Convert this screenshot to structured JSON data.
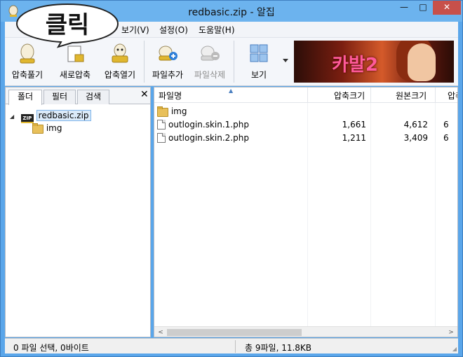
{
  "window": {
    "title": "redbasic.zip - 알집",
    "minimize_glyph": "—",
    "maximize_glyph": "□",
    "close_glyph": "✕"
  },
  "menu": {
    "items": [
      "보기(V)",
      "설정(O)",
      "도움말(H)"
    ]
  },
  "callout": {
    "text": "클릭"
  },
  "toolbar": {
    "buttons": [
      {
        "label": "압축풀기",
        "icon": "extract-egg-icon"
      },
      {
        "label": "새로압축",
        "icon": "new-archive-icon"
      },
      {
        "label": "압축열기",
        "icon": "open-archive-icon"
      },
      {
        "label": "파일추가",
        "icon": "add-file-icon"
      },
      {
        "label": "파일삭제",
        "icon": "delete-file-icon",
        "disabled": true
      },
      {
        "label": "보기",
        "icon": "view-grid-icon"
      }
    ]
  },
  "banner": {
    "text": "카발2"
  },
  "left_panel": {
    "tabs": [
      "폴더",
      "필터",
      "검색"
    ],
    "active_tab": "폴더",
    "close_glyph": "✕",
    "tree": {
      "root": {
        "label": "redbasic.zip",
        "badge": "ZIP",
        "expander": "◢"
      },
      "children": [
        {
          "label": "img"
        }
      ]
    }
  },
  "file_list": {
    "columns": [
      "파일명",
      "압축크기",
      "원본크기",
      "압축"
    ],
    "sort_glyph": "▲",
    "rows": [
      {
        "name": "img",
        "type": "folder",
        "packed": "",
        "original": "",
        "ratio": ""
      },
      {
        "name": "outlogin.skin.1.php",
        "type": "file",
        "packed": "1,661",
        "original": "4,612",
        "ratio": "6"
      },
      {
        "name": "outlogin.skin.2.php",
        "type": "file",
        "packed": "1,211",
        "original": "3,409",
        "ratio": "6"
      }
    ],
    "scroll_left_glyph": "<",
    "scroll_right_glyph": ">"
  },
  "status": {
    "left": "0 파일 선택, 0바이트",
    "right": "총 9파일, 11.8KB"
  },
  "colors": {
    "frame": "#5aa6ea",
    "close_button": "#c7504a",
    "selection": "#dbeaf9"
  }
}
